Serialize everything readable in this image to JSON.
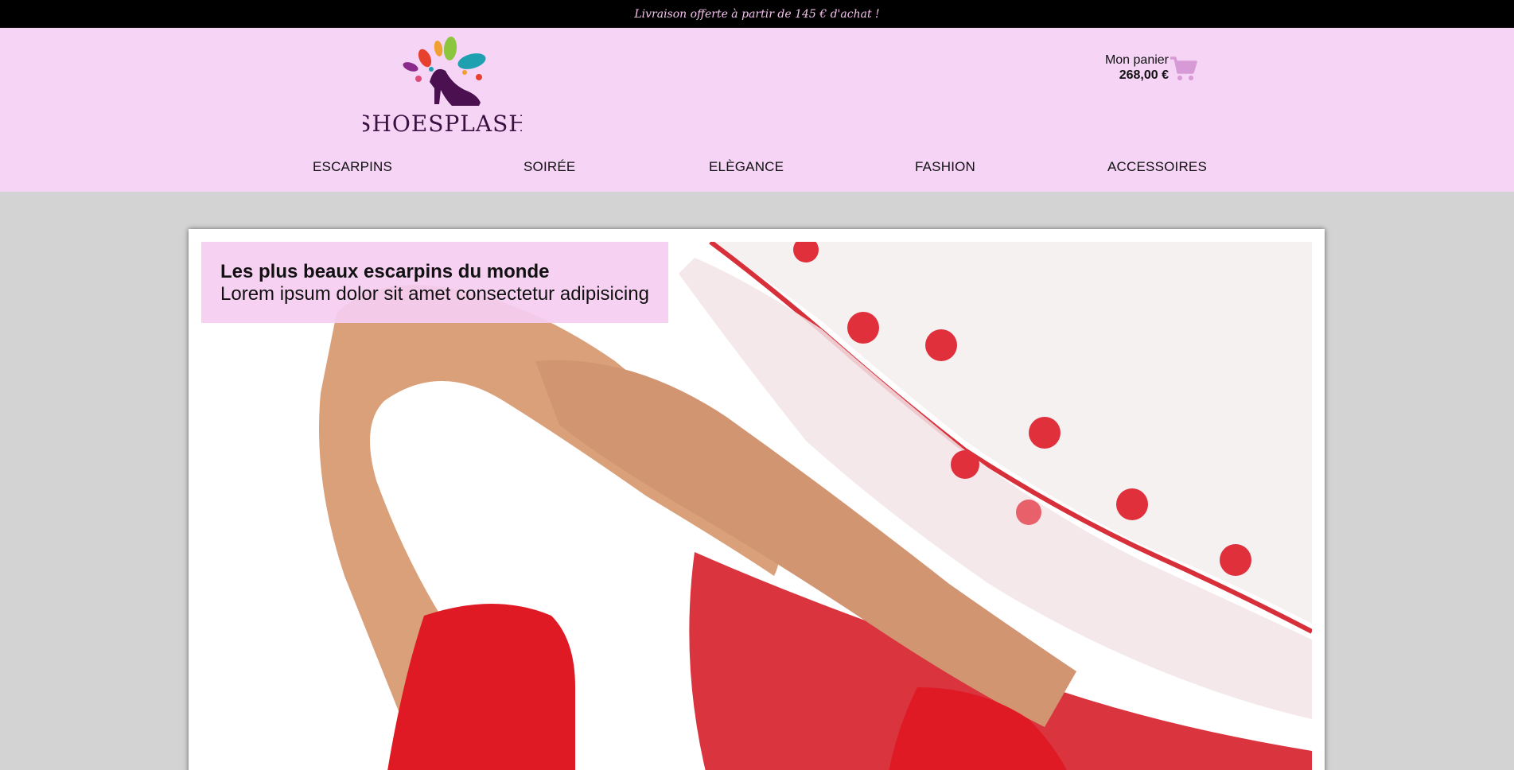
{
  "promo_bar": {
    "text": "Livraison offerte à partir de 145 € d'achat !"
  },
  "brand": {
    "logo_text": "SHOESPLASH",
    "logo_icon": "splash-heel-icon"
  },
  "cart": {
    "label": "Mon panier",
    "total": "268,00 €",
    "icon": "cart-icon",
    "icon_color": "#d89ad6"
  },
  "nav": {
    "items": [
      {
        "label": "ESCARPINS"
      },
      {
        "label": "SOIRÉE"
      },
      {
        "label": "ELÈGANCE"
      },
      {
        "label": "FASHION"
      },
      {
        "label": "ACCESSOIRES"
      }
    ]
  },
  "hero": {
    "title": "Les plus beaux escarpins du monde",
    "subtitle": "Lorem ipsum dolor sit amet consectetur adipisicing",
    "image": "legs-red-pumps-polka-dot-dress-photo"
  },
  "colors": {
    "topbar_bg": "#000000",
    "topbar_text": "#f4c3ec",
    "header_bg": "#f5d4f5",
    "page_bg": "#d3d3d3",
    "caption_bg": "#f5cdf0"
  }
}
